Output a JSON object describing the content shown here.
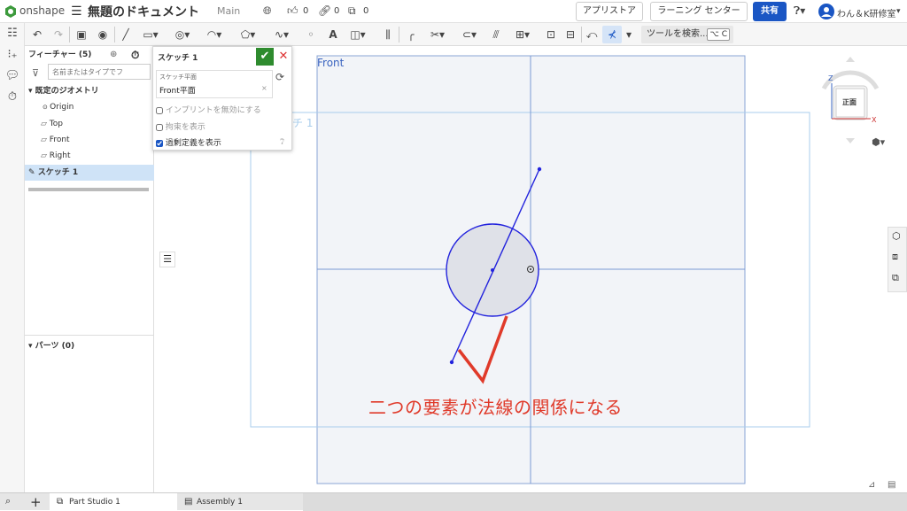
{
  "topbar": {
    "logo_text": "onshape",
    "doc_title": "無題のドキュメント",
    "workspace": "Main",
    "likes": "0",
    "links": "0",
    "copies": "0",
    "app_store": "アプリストア",
    "learning_center": "ラーニング センター",
    "share": "共有",
    "user": "わん＆K研修室"
  },
  "toolbar": {
    "tool_search": "ツールを検索...",
    "tool_search_shortcut": "⌥ C"
  },
  "feature_panel": {
    "header": "フィーチャー (5)",
    "filter_placeholder": "名前またはタイプでフ",
    "default_geometry": "既定のジオメトリ",
    "items": [
      "Origin",
      "Top",
      "Front",
      "Right"
    ],
    "sketch_item": "スケッチ 1",
    "parts": "パーツ (0)"
  },
  "sketch_dialog": {
    "title": "スケッチ 1",
    "plane_label": "スケッチ平面",
    "plane_value": "Front平面",
    "opt1": "インプリントを無効にする",
    "opt2": "拘束を表示",
    "opt3": "過剰定義を表示",
    "opt1_checked": false,
    "opt2_checked": false,
    "opt3_checked": true
  },
  "viewport": {
    "plane_label": "Front",
    "sketch_label": "スケッチ 1",
    "view_cube_label": "正面",
    "axis_z": "Z",
    "axis_x": "X",
    "annotation": "二つの要素が法線の関係になる"
  },
  "tabs": {
    "part_studio": "Part Studio 1",
    "assembly": "Assembly 1"
  },
  "colors": {
    "accent": "#1a56c4",
    "sketch_blue": "#1a1aff",
    "annotation_red": "#e03a2a",
    "plane_fill": "#f2f4f8"
  }
}
